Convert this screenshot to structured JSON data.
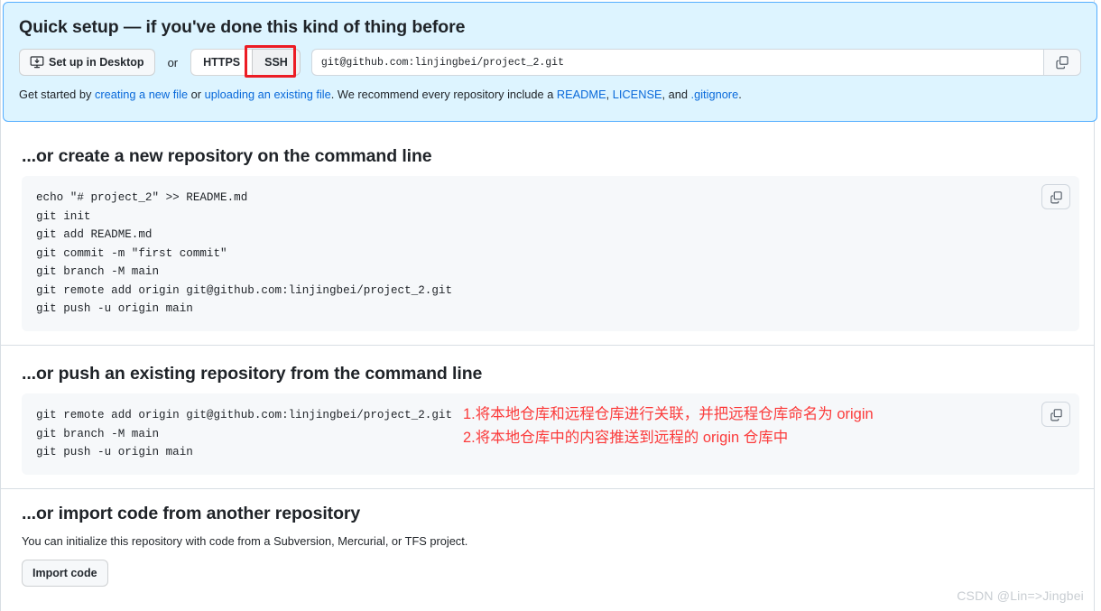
{
  "quick_setup": {
    "title": "Quick setup — if you've done this kind of thing before",
    "desktop_button": "Set up in Desktop",
    "or_label": "or",
    "protocol_https": "HTTPS",
    "protocol_ssh": "SSH",
    "selected_protocol": "SSH",
    "remote_url": "git@github.com:linjingbei/project_2.git",
    "copy_icon": "copy-icon",
    "highlight_color": "#ec1c24",
    "banner_bg": "#ddf4ff",
    "banner_border": "#54aeff",
    "hint": {
      "prefix": "Get started by ",
      "link_create": "creating a new file",
      "mid1": " or ",
      "link_upload": "uploading an existing file",
      "mid2": ". We recommend every repository include a ",
      "link_readme": "README",
      "sep1": ", ",
      "link_license": "LICENSE",
      "sep2": ", and ",
      "link_gitignore": ".gitignore",
      "suffix": "."
    }
  },
  "create_section": {
    "title": "...or create a new repository on the command line",
    "copy_icon": "copy-icon",
    "lines": [
      "echo \"# project_2\" >> README.md",
      "git init",
      "git add README.md",
      "git commit -m \"first commit\"",
      "git branch -M main",
      "git remote add origin git@github.com:linjingbei/project_2.git",
      "git push -u origin main"
    ]
  },
  "push_section": {
    "title": "...or push an existing repository from the command line",
    "copy_icon": "copy-icon",
    "lines": [
      "git remote add origin git@github.com:linjingbei/project_2.git",
      "git branch -M main",
      "git push -u origin main"
    ],
    "annotation": {
      "color": "#fb3b3b",
      "line1": "1.将本地仓库和远程仓库进行关联，并把远程仓库命名为 origin",
      "line2": "2.将本地仓库中的内容推送到远程的 origin 仓库中"
    }
  },
  "import_section": {
    "title": "...or import code from another repository",
    "description": "You can initialize this repository with code from a Subversion, Mercurial, or TFS project.",
    "button": "Import code"
  },
  "watermark": "CSDN @Lin=>Jingbei"
}
